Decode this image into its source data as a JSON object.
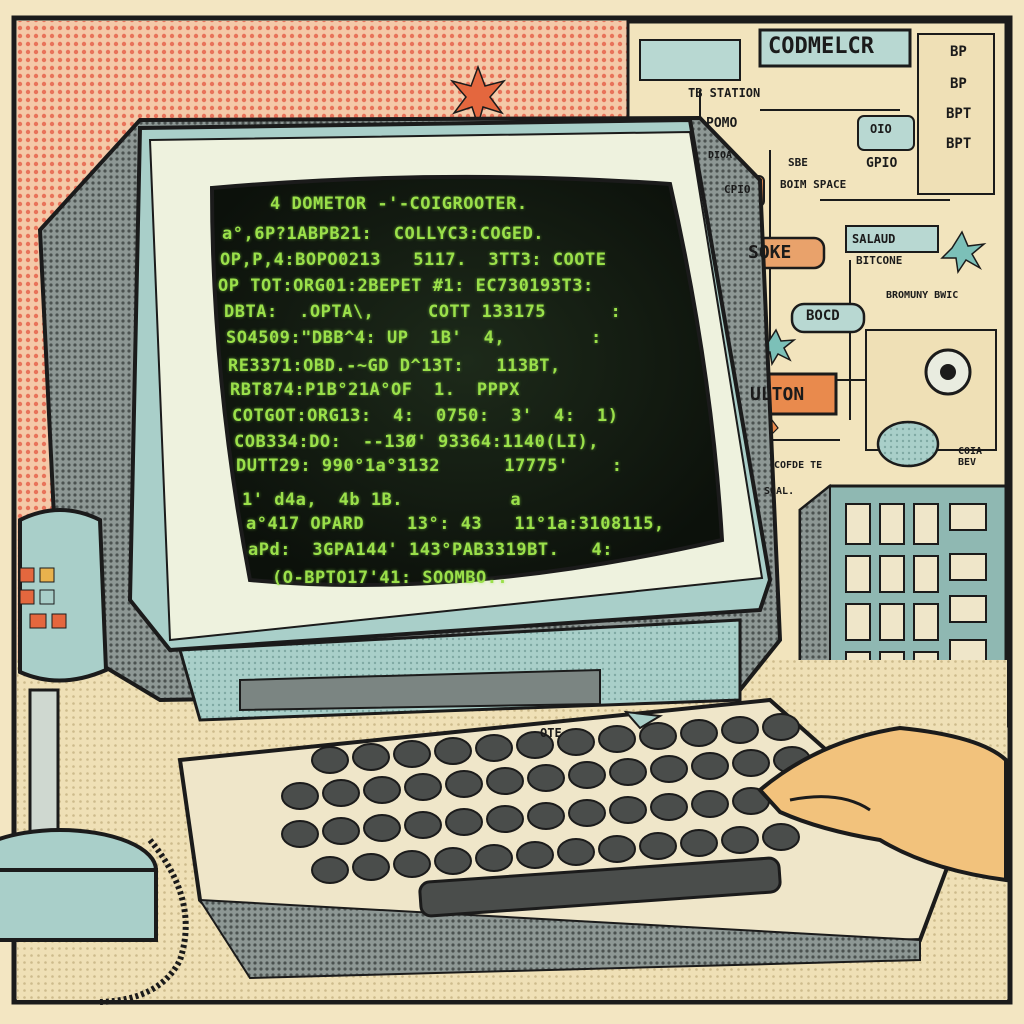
{
  "screen": {
    "lines": [
      "4 DOMETOR -'-COIGROOTER.",
      "a°,6P?1ABPB21:  COLLYC3:COGED.",
      "OP,P,4:BOPO0213   5117.  3TT3: COOTE",
      "OP TOT:ORG01:2BEPET #1: EC730193T3:",
      "DBTA:  .OPTA\\,     COTT 133175      :",
      "SO4509:\"DBB^4: UP  1B'  4,        :",
      "RE3371:OBD.-~GD D^13T:   113BT,",
      "RBT874:P1B°21A°OF  1.  PPPX",
      "COTGOT:ORG13:  4:  0750:  3'  4:  1)",
      "COB334:DO:  --13Ø' 93364:1140(LI),",
      "DUTT29: 990°1a°3132      17775'    :",
      "1' d4a,  4b 1B.          a",
      "a°417 OPARD    13°: 43   11°1a:3108115,",
      "aPd:  3GPA144' 143°PAB3319BT.   4:",
      "(O-BPTO17'41: SOOMBO.."
    ]
  },
  "wall_labels": {
    "header": "CODMELCR",
    "tb_station": "TB STATION",
    "pomo": "POMO",
    "oio": "OIO",
    "dioa": "DIOA",
    "gpio": "GPIO",
    "cpio": "CPIO",
    "sbe": "SBE",
    "boim_space": "BOIM SPACE",
    "soke": "SOKE",
    "salaud": "SALAUD",
    "bitcone": "BITCONE",
    "bocd": "BOCD",
    "brom_swic": "BROMUNY BWIC",
    "ulton": "ULTON",
    "coi_bev": "COIA BEV",
    "cofde_te": "COFDE TE",
    "soal": "SOAL.",
    "side_b1": "BP",
    "side_b2": "BP",
    "side_b3": "BPT",
    "side_b4": "BPT"
  },
  "keyboard": {
    "marker": "OTE"
  },
  "colors": {
    "screen_text": "#9be04a",
    "bezel": "#a9cfc9",
    "paper": "#f3e6c2",
    "halftone_red": "#e8735a",
    "ink": "#1b1b1b"
  }
}
